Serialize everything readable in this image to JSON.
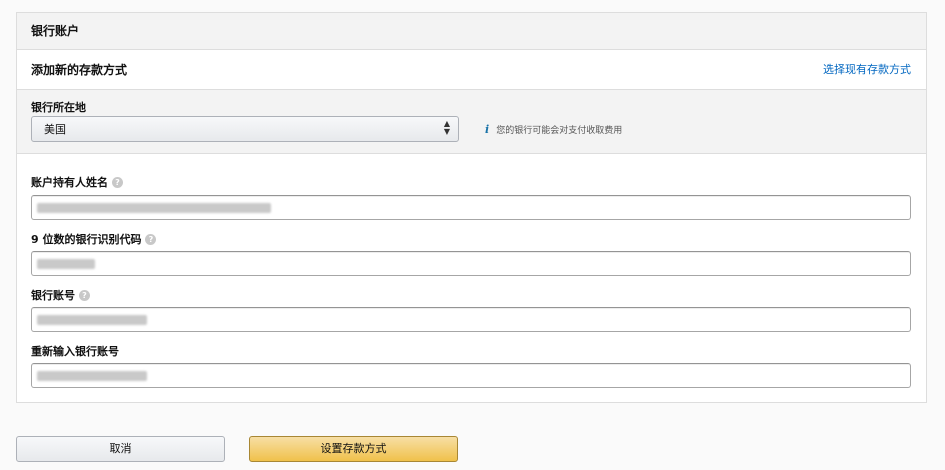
{
  "panel": {
    "title": "银行账户"
  },
  "add_section": {
    "title": "添加新的存款方式",
    "select_existing_link": "选择现有存款方式"
  },
  "bank_location": {
    "label": "银行所在地",
    "selected_country": "美国",
    "fee_notice": "您的银行可能会对支付收取费用"
  },
  "fields": {
    "account_holder_name": {
      "label": "账户持有人姓名",
      "value_redacted": true
    },
    "routing_number": {
      "label": "9 位数的银行识别代码",
      "value_redacted": true
    },
    "account_number": {
      "label": "银行账号",
      "value_redacted": true
    },
    "reenter_account_number": {
      "label": "重新输入银行账号",
      "value_redacted": true
    }
  },
  "buttons": {
    "cancel": "取消",
    "submit": "设置存款方式"
  },
  "colors": {
    "link": "#0066c0",
    "primary_button": "#f0c14b",
    "info_icon": "#1a73a8"
  },
  "icons": {
    "help": "question-circle-icon",
    "info": "info-icon",
    "select_arrows": "up-down-arrows-icon"
  }
}
